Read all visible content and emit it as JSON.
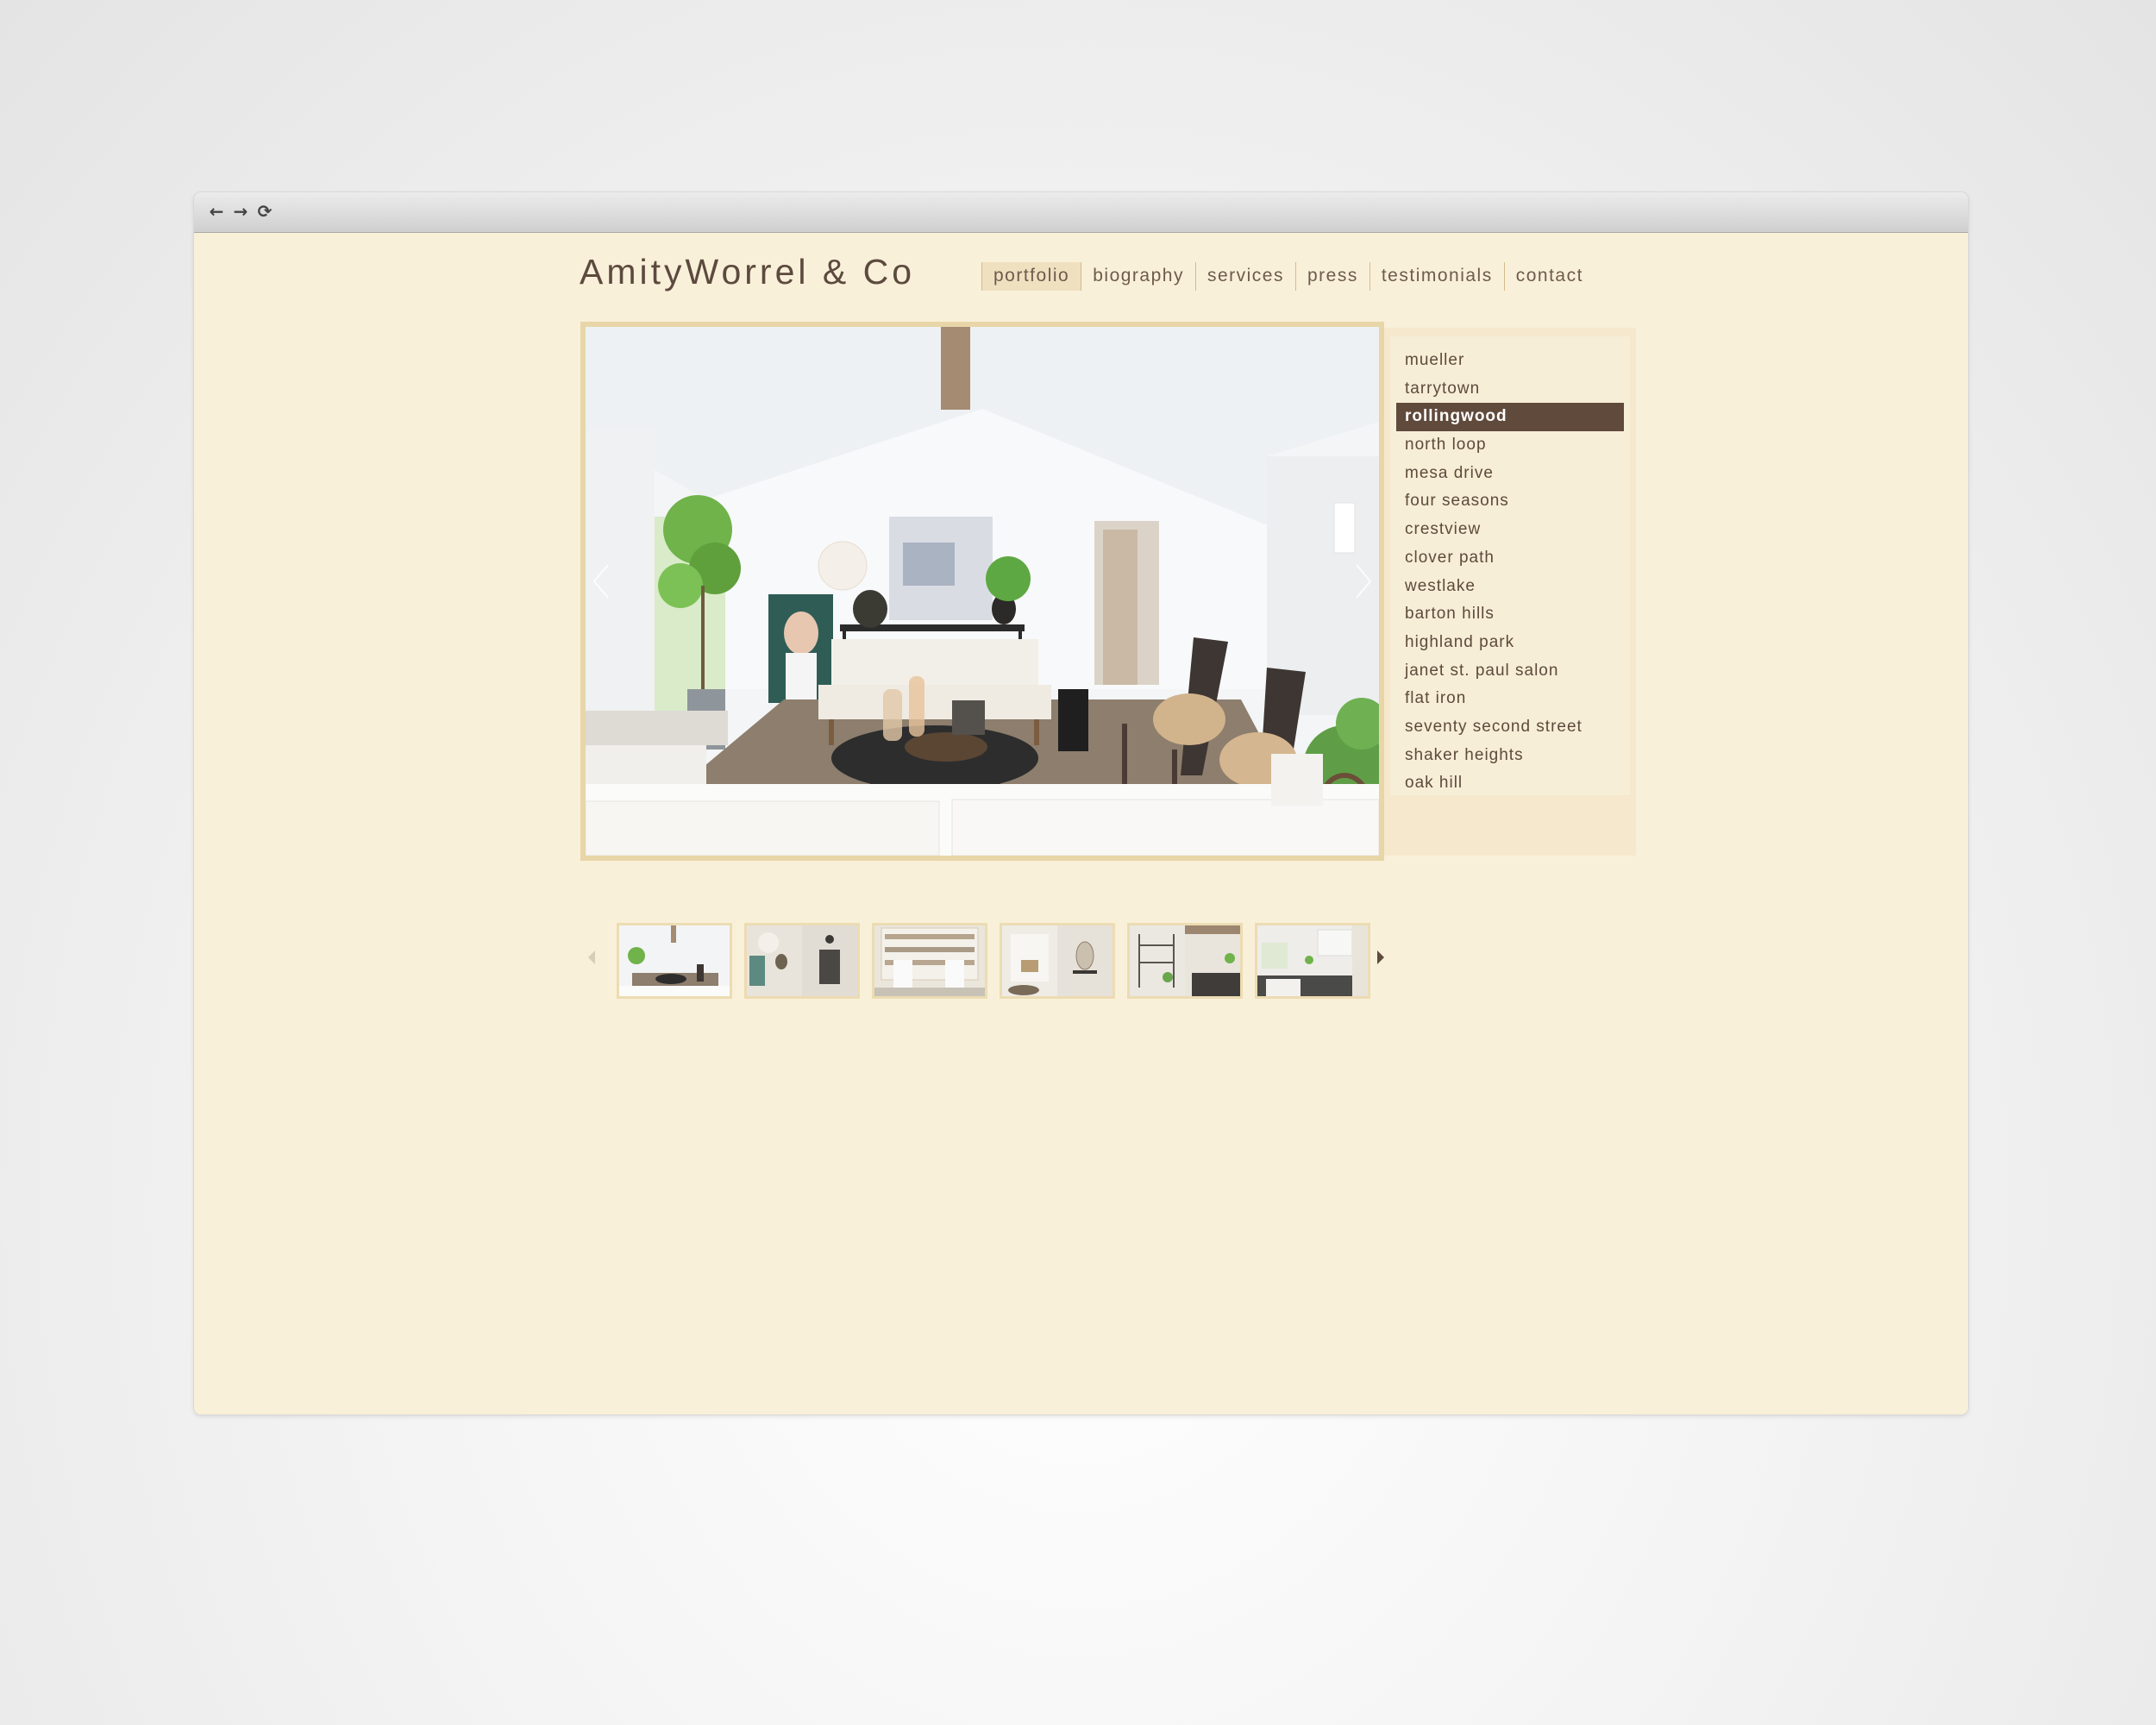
{
  "browser": {
    "back_icon": "back-arrow-icon",
    "forward_icon": "forward-arrow-icon",
    "reload_icon": "reload-icon",
    "back_glyph": "←",
    "forward_glyph": "→",
    "reload_glyph": "⟳"
  },
  "site": {
    "logo": "AmityWorrel & Co",
    "nav": [
      {
        "label": "portfolio",
        "active": true
      },
      {
        "label": "biography",
        "active": false
      },
      {
        "label": "services",
        "active": false
      },
      {
        "label": "press",
        "active": false
      },
      {
        "label": "testimonials",
        "active": false
      },
      {
        "label": "contact",
        "active": false
      }
    ]
  },
  "gallery": {
    "main_image": "living room interior with white sofa, round black coffee table, two dark lounge chairs, fiddle leaf fig, vaulted ceiling with wood beam",
    "prev_icon": "chevron-left-icon",
    "next_icon": "chevron-right-icon",
    "thumbnails": [
      {
        "alt": "living room",
        "selected": true
      },
      {
        "alt": "entry with artwork and door",
        "selected": false
      },
      {
        "alt": "bookshelf with white chairs",
        "selected": false
      },
      {
        "alt": "fireplace and dining mirror",
        "selected": false
      },
      {
        "alt": "shelving and kitchen",
        "selected": false
      },
      {
        "alt": "kitchen",
        "selected": false
      }
    ]
  },
  "projects": {
    "selected": "rollingwood",
    "items": [
      "mueller",
      "tarrytown",
      "rollingwood",
      "north loop",
      "mesa drive",
      "four seasons",
      "crestview",
      "clover path",
      "westlake",
      "barton hills",
      "highland park",
      "janet st. paul salon",
      "flat iron",
      "seventy second street",
      "shaker heights",
      "oak hill"
    ]
  },
  "colors": {
    "page_bg": "#f9f0d9",
    "frame": "#e8d6a8",
    "accent_dark": "#604a3c",
    "text": "#5e4a3c"
  }
}
